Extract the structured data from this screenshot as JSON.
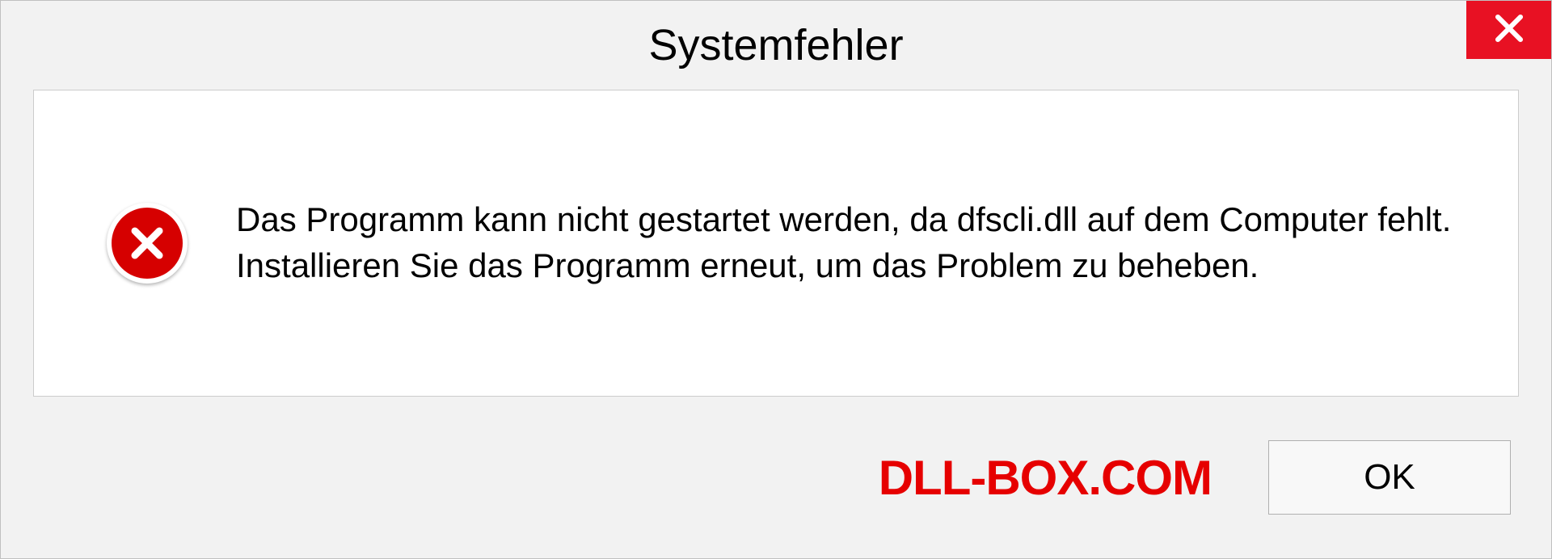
{
  "dialog": {
    "title": "Systemfehler",
    "message": "Das Programm kann nicht gestartet werden, da dfscli.dll auf dem Computer fehlt. Installieren Sie das Programm erneut, um das Problem zu beheben.",
    "ok_label": "OK"
  },
  "watermark": {
    "text": "DLL-BOX.COM"
  },
  "colors": {
    "close_red": "#e81123",
    "error_red": "#d60000",
    "watermark_red": "#e60000"
  }
}
